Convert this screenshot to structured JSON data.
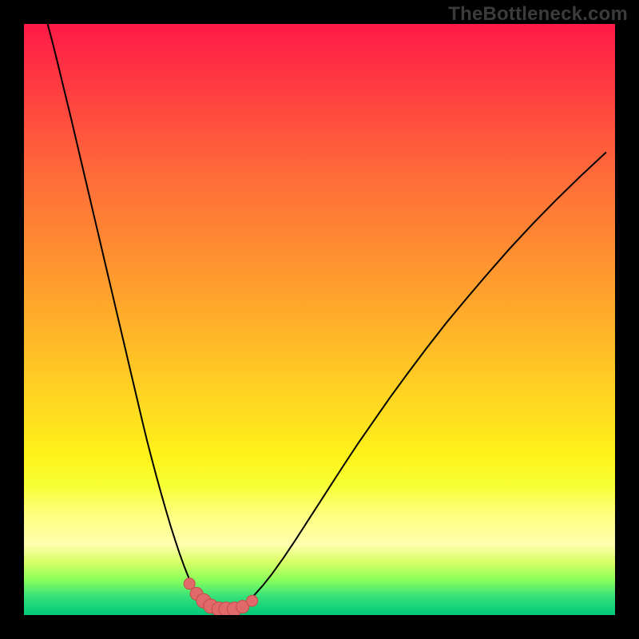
{
  "brand": "TheBottleneck.com",
  "colors": {
    "gradient_top": "#ff1a47",
    "gradient_bottom": "#00c97a",
    "curve": "#000000",
    "marker_fill": "#e06a6a",
    "marker_stroke": "#c84a4a"
  },
  "chart_data": {
    "type": "line",
    "title": "",
    "xlabel": "",
    "ylabel": "",
    "xlim": [
      0,
      100
    ],
    "ylim": [
      0,
      100
    ],
    "x": [
      4.0,
      4.8,
      5.6,
      6.4,
      7.2,
      8.0,
      8.8,
      9.6,
      10.4,
      11.2,
      12.0,
      12.8,
      13.6,
      14.4,
      15.2,
      16.0,
      16.8,
      17.6,
      18.4,
      19.2,
      20.0,
      20.8,
      21.6,
      22.4,
      23.2,
      24.0,
      24.8,
      25.6,
      26.4,
      27.2,
      28.0,
      29.0,
      30.0,
      31.0,
      32.0,
      33.0,
      34.0,
      35.0,
      36.0,
      37.5,
      39.0,
      40.5,
      42.0,
      44.0,
      46.0,
      48.0,
      50.0,
      52.0,
      54.0,
      56.5,
      59.0,
      62.0,
      65.0,
      68.0,
      71.5,
      75.0,
      78.5,
      82.0,
      86.0,
      90.0,
      94.0,
      98.5
    ],
    "values": [
      100.0,
      97.0,
      93.8,
      90.5,
      87.2,
      83.9,
      80.5,
      77.1,
      73.7,
      70.3,
      66.9,
      63.5,
      60.1,
      56.7,
      53.3,
      49.9,
      46.5,
      43.1,
      39.7,
      36.3,
      32.9,
      29.6,
      26.5,
      23.5,
      20.6,
      17.8,
      15.1,
      12.6,
      10.2,
      8.0,
      6.0,
      4.2,
      2.8,
      1.8,
      1.1,
      0.7,
      0.6,
      0.7,
      1.1,
      2.0,
      3.4,
      5.1,
      7.0,
      9.8,
      12.8,
      15.9,
      19.0,
      22.1,
      25.2,
      29.0,
      32.6,
      36.9,
      41.0,
      45.0,
      49.5,
      53.7,
      57.8,
      61.8,
      66.1,
      70.2,
      74.1,
      78.3
    ],
    "markers": {
      "x": [
        28.0,
        29.2,
        30.4,
        31.6,
        33.0,
        34.2,
        35.6,
        37.0,
        38.6
      ],
      "y": [
        5.3,
        3.6,
        2.4,
        1.5,
        1.0,
        1.0,
        1.0,
        1.4,
        2.4
      ],
      "size": [
        7,
        8,
        9,
        9,
        9,
        9,
        9,
        8,
        7
      ]
    }
  }
}
